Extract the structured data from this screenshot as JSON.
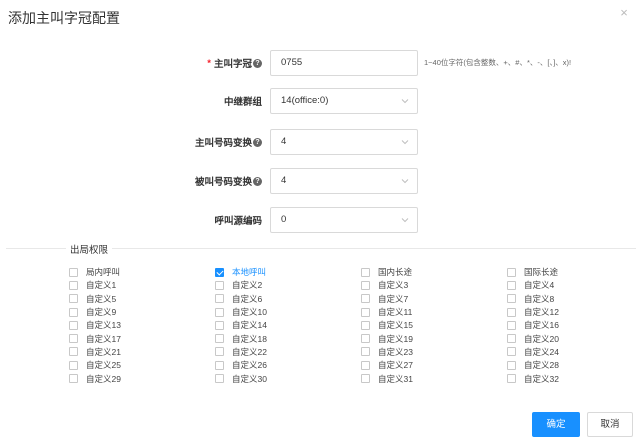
{
  "dialog": {
    "title": "添加主叫字冠配置",
    "close_glyph": "×"
  },
  "form": {
    "prefix": {
      "label": "主叫字冠",
      "required_mark": "*",
      "value": "0755",
      "hint": "1~40位字符(包含整数、+、#、*、-、[、]、x)!"
    },
    "relay_group": {
      "label": "中继群组",
      "value": "14(office:0)"
    },
    "caller_transform": {
      "label": "主叫号码变换",
      "value": "4"
    },
    "callee_transform": {
      "label": "被叫号码变换",
      "value": "4"
    },
    "call_source_code": {
      "label": "呼叫源编码",
      "value": "0"
    }
  },
  "permissions": {
    "section_label": "出局权限",
    "items": [
      {
        "label": "局内呼叫",
        "checked": false
      },
      {
        "label": "本地呼叫",
        "checked": true
      },
      {
        "label": "国内长途",
        "checked": false
      },
      {
        "label": "国际长途",
        "checked": false
      },
      {
        "label": "自定义1",
        "checked": false
      },
      {
        "label": "自定义2",
        "checked": false
      },
      {
        "label": "自定义3",
        "checked": false
      },
      {
        "label": "自定义4",
        "checked": false
      },
      {
        "label": "自定义5",
        "checked": false
      },
      {
        "label": "自定义6",
        "checked": false
      },
      {
        "label": "自定义7",
        "checked": false
      },
      {
        "label": "自定义8",
        "checked": false
      },
      {
        "label": "自定义9",
        "checked": false
      },
      {
        "label": "自定义10",
        "checked": false
      },
      {
        "label": "自定义11",
        "checked": false
      },
      {
        "label": "自定义12",
        "checked": false
      },
      {
        "label": "自定义13",
        "checked": false
      },
      {
        "label": "自定义14",
        "checked": false
      },
      {
        "label": "自定义15",
        "checked": false
      },
      {
        "label": "自定义16",
        "checked": false
      },
      {
        "label": "自定义17",
        "checked": false
      },
      {
        "label": "自定义18",
        "checked": false
      },
      {
        "label": "自定义19",
        "checked": false
      },
      {
        "label": "自定义20",
        "checked": false
      },
      {
        "label": "自定义21",
        "checked": false
      },
      {
        "label": "自定义22",
        "checked": false
      },
      {
        "label": "自定义23",
        "checked": false
      },
      {
        "label": "自定义24",
        "checked": false
      },
      {
        "label": "自定义25",
        "checked": false
      },
      {
        "label": "自定义26",
        "checked": false
      },
      {
        "label": "自定义27",
        "checked": false
      },
      {
        "label": "自定义28",
        "checked": false
      },
      {
        "label": "自定义29",
        "checked": false
      },
      {
        "label": "自定义30",
        "checked": false
      },
      {
        "label": "自定义31",
        "checked": false
      },
      {
        "label": "自定义32",
        "checked": false
      }
    ]
  },
  "footer": {
    "ok_label": "确定",
    "cancel_label": "取消"
  },
  "colors": {
    "primary": "#1890ff",
    "required": "#f5222d"
  },
  "icons": {
    "help": "question-circle-icon",
    "select_arrow": "chevron-down-icon",
    "close": "close-icon"
  }
}
